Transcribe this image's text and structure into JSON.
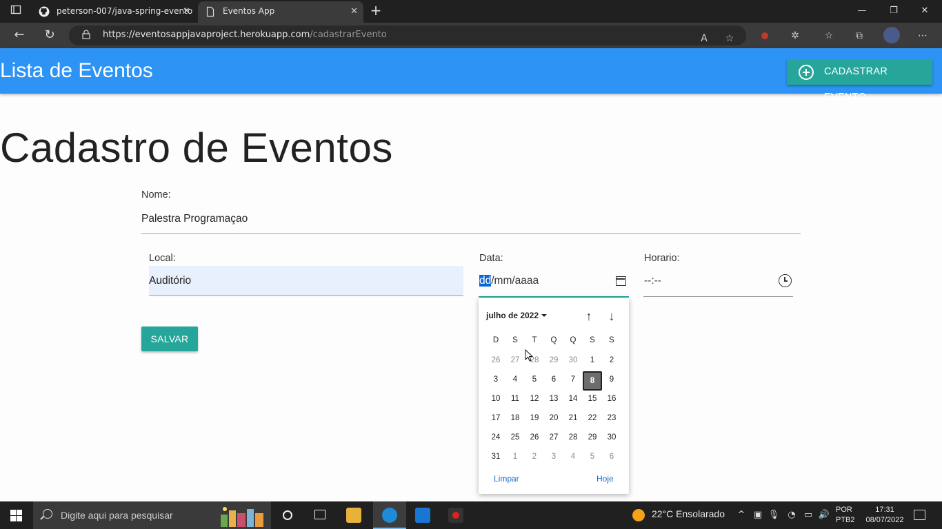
{
  "browser": {
    "tabs": [
      {
        "title": "peterson-007/java-spring-evento",
        "active": false
      },
      {
        "title": "Eventos App",
        "active": true
      }
    ],
    "url_host": "https://eventosappjavaproject.herokuapp.com",
    "url_path": "/cadastrarEvento"
  },
  "header": {
    "title": "Lista de Eventos",
    "cadastrar_button": "CADASTRAR EVENTO",
    "bar_color": "#2d93f4",
    "button_color": "#26a69a"
  },
  "form": {
    "page_title": "Cadastro de Eventos",
    "nome_label": "Nome:",
    "nome_value": "Palestra Programaçao",
    "local_label": "Local:",
    "local_value": "Auditório",
    "data_label": "Data:",
    "data_value_selected": "dd",
    "data_value_rest": "/mm/aaaa",
    "horario_label": "Horario:",
    "horario_value": "--:--",
    "salvar_button": "SALVAR"
  },
  "datepicker": {
    "month_label": "julho de 2022",
    "weekdays": [
      "D",
      "S",
      "T",
      "Q",
      "Q",
      "S",
      "S"
    ],
    "weeks": [
      [
        {
          "d": "26",
          "m": true
        },
        {
          "d": "27",
          "m": true
        },
        {
          "d": "28",
          "m": true
        },
        {
          "d": "29",
          "m": true
        },
        {
          "d": "30",
          "m": true
        },
        {
          "d": "1"
        },
        {
          "d": "2"
        }
      ],
      [
        {
          "d": "3"
        },
        {
          "d": "4"
        },
        {
          "d": "5"
        },
        {
          "d": "6"
        },
        {
          "d": "7"
        },
        {
          "d": "8",
          "today": true
        },
        {
          "d": "9"
        }
      ],
      [
        {
          "d": "10"
        },
        {
          "d": "11"
        },
        {
          "d": "12"
        },
        {
          "d": "13"
        },
        {
          "d": "14"
        },
        {
          "d": "15"
        },
        {
          "d": "16"
        }
      ],
      [
        {
          "d": "17"
        },
        {
          "d": "18"
        },
        {
          "d": "19"
        },
        {
          "d": "20"
        },
        {
          "d": "21"
        },
        {
          "d": "22"
        },
        {
          "d": "23"
        }
      ],
      [
        {
          "d": "24"
        },
        {
          "d": "25"
        },
        {
          "d": "26"
        },
        {
          "d": "27"
        },
        {
          "d": "28"
        },
        {
          "d": "29"
        },
        {
          "d": "30"
        }
      ],
      [
        {
          "d": "31"
        },
        {
          "d": "1",
          "m": true
        },
        {
          "d": "2",
          "m": true
        },
        {
          "d": "3",
          "m": true
        },
        {
          "d": "4",
          "m": true
        },
        {
          "d": "5",
          "m": true
        },
        {
          "d": "6",
          "m": true
        }
      ]
    ],
    "clear_label": "Limpar",
    "today_label": "Hoje"
  },
  "taskbar": {
    "search_placeholder": "Digite aqui para pesquisar",
    "weather": "22°C  Ensolarado",
    "lang_line1": "POR",
    "lang_line2": "PTB2",
    "time": "17:31",
    "date": "08/07/2022"
  }
}
